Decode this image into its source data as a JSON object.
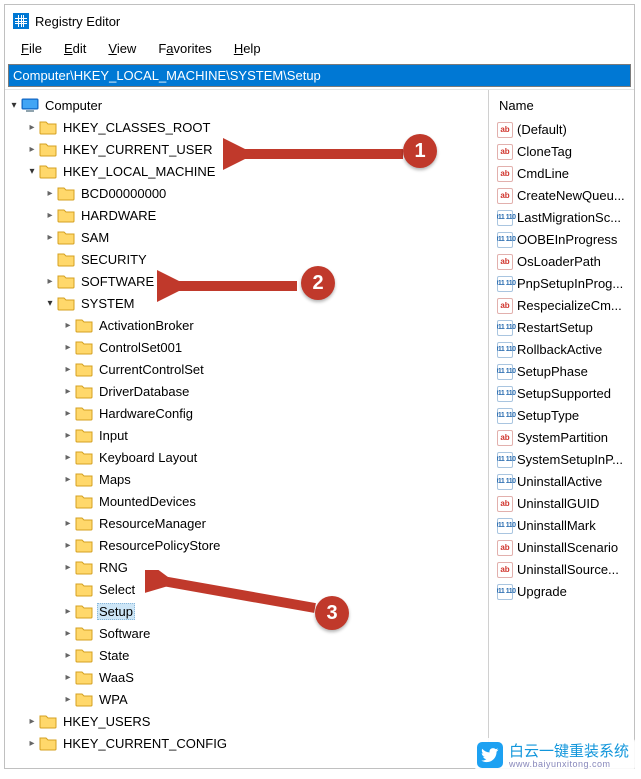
{
  "window": {
    "title": "Registry Editor"
  },
  "menu": {
    "file": "File",
    "edit": "Edit",
    "view": "View",
    "favorites": "Favorites",
    "help": "Help"
  },
  "addressbar": "Computer\\HKEY_LOCAL_MACHINE\\SYSTEM\\Setup",
  "tree": {
    "root": "Computer",
    "hkcr": "HKEY_CLASSES_ROOT",
    "hkcu": "HKEY_CURRENT_USER",
    "hklm": "HKEY_LOCAL_MACHINE",
    "hklm_children": {
      "bcd": "BCD00000000",
      "hardware": "HARDWARE",
      "sam": "SAM",
      "security": "SECURITY",
      "software": "SOFTWARE",
      "system": "SYSTEM",
      "system_children": {
        "activationbroker": "ActivationBroker",
        "controlset001": "ControlSet001",
        "currentcontrolset": "CurrentControlSet",
        "driverdatabase": "DriverDatabase",
        "hardwareconfig": "HardwareConfig",
        "input": "Input",
        "keyboardlayout": "Keyboard Layout",
        "maps": "Maps",
        "mounteddevices": "MountedDevices",
        "resourcemanager": "ResourceManager",
        "resourcepolicystore": "ResourcePolicyStore",
        "rng": "RNG",
        "select": "Select",
        "setup": "Setup",
        "software2": "Software",
        "state": "State",
        "waas": "WaaS",
        "wpa": "WPA"
      }
    },
    "hku": "HKEY_USERS",
    "hkcc": "HKEY_CURRENT_CONFIG"
  },
  "values_header": "Name",
  "values": [
    {
      "type": "sz",
      "name": "(Default)"
    },
    {
      "type": "sz",
      "name": "CloneTag"
    },
    {
      "type": "sz",
      "name": "CmdLine"
    },
    {
      "type": "sz",
      "name": "CreateNewQueu..."
    },
    {
      "type": "bin",
      "name": "LastMigrationSc..."
    },
    {
      "type": "bin",
      "name": "OOBEInProgress"
    },
    {
      "type": "sz",
      "name": "OsLoaderPath"
    },
    {
      "type": "bin",
      "name": "PnpSetupInProg..."
    },
    {
      "type": "sz",
      "name": "RespecializeCm..."
    },
    {
      "type": "bin",
      "name": "RestartSetup"
    },
    {
      "type": "bin",
      "name": "RollbackActive"
    },
    {
      "type": "bin",
      "name": "SetupPhase"
    },
    {
      "type": "bin",
      "name": "SetupSupported"
    },
    {
      "type": "bin",
      "name": "SetupType"
    },
    {
      "type": "sz",
      "name": "SystemPartition"
    },
    {
      "type": "bin",
      "name": "SystemSetupInP..."
    },
    {
      "type": "bin",
      "name": "UninstallActive"
    },
    {
      "type": "sz",
      "name": "UninstallGUID"
    },
    {
      "type": "bin",
      "name": "UninstallMark"
    },
    {
      "type": "sz",
      "name": "UninstallScenario"
    },
    {
      "type": "sz",
      "name": "UninstallSource..."
    },
    {
      "type": "bin",
      "name": "Upgrade"
    }
  ],
  "annotations": {
    "badge1": "1",
    "badge2": "2",
    "badge3": "3"
  },
  "watermark": {
    "text": "白云一键重装系统",
    "sub": "www.baiyunxitong.com"
  }
}
